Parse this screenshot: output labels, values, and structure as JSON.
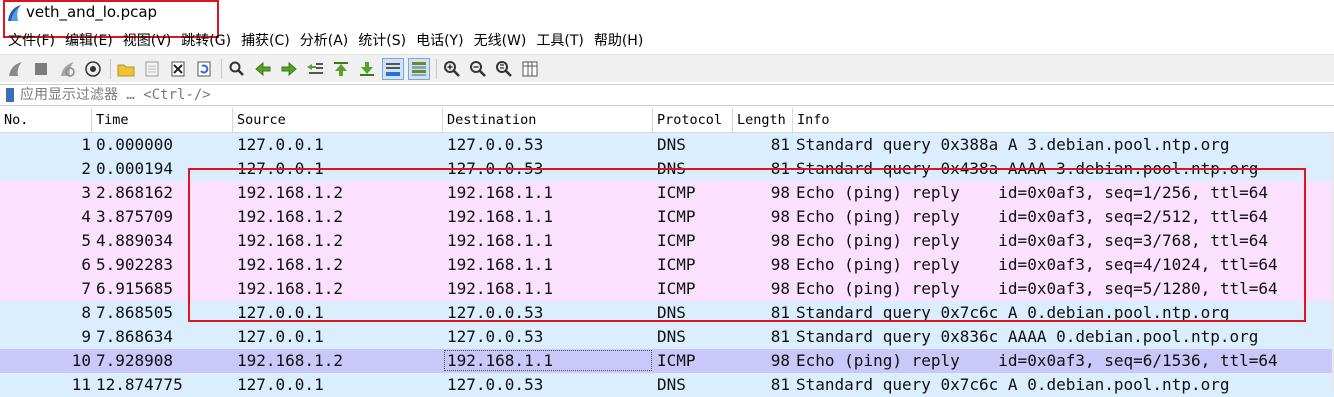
{
  "window": {
    "title": "veth_and_lo.pcap",
    "icon": "wireshark-fin-icon"
  },
  "menu": [
    "文件(F)",
    "编辑(E)",
    "视图(V)",
    "跳转(G)",
    "捕获(C)",
    "分析(A)",
    "统计(S)",
    "电话(Y)",
    "无线(W)",
    "工具(T)",
    "帮助(H)"
  ],
  "toolbar": {
    "icons": [
      "start-capture-icon",
      "stop-capture-icon",
      "restart-capture-icon",
      "capture-options-icon",
      "open-file-icon",
      "save-file-icon",
      "close-file-icon",
      "reload-file-icon",
      "find-packet-icon",
      "go-back-icon",
      "go-forward-icon",
      "go-to-packet-icon",
      "go-first-icon",
      "go-last-icon",
      "autoscroll-icon",
      "colorize-icon",
      "zoom-in-icon",
      "zoom-out-icon",
      "zoom-normal-icon",
      "resize-columns-icon"
    ]
  },
  "filter": {
    "placeholder": "应用显示过滤器 … <Ctrl-/>"
  },
  "columns": {
    "no": "No.",
    "time": "Time",
    "source": "Source",
    "destination": "Destination",
    "protocol": "Protocol",
    "length": "Length",
    "info": "Info"
  },
  "packets": [
    {
      "no": "1",
      "time": "0.000000",
      "src": "127.0.0.1",
      "dst": "127.0.0.53",
      "proto": "DNS",
      "len": "81",
      "info": "Standard query 0x388a A 3.debian.pool.ntp.org"
    },
    {
      "no": "2",
      "time": "0.000194",
      "src": "127.0.0.1",
      "dst": "127.0.0.53",
      "proto": "DNS",
      "len": "81",
      "info": "Standard query 0x438a AAAA 3.debian.pool.ntp.org"
    },
    {
      "no": "3",
      "time": "2.868162",
      "src": "192.168.1.2",
      "dst": "192.168.1.1",
      "proto": "ICMP",
      "len": "98",
      "info": "Echo (ping) reply    id=0x0af3, seq=1/256, ttl=64"
    },
    {
      "no": "4",
      "time": "3.875709",
      "src": "192.168.1.2",
      "dst": "192.168.1.1",
      "proto": "ICMP",
      "len": "98",
      "info": "Echo (ping) reply    id=0x0af3, seq=2/512, ttl=64"
    },
    {
      "no": "5",
      "time": "4.889034",
      "src": "192.168.1.2",
      "dst": "192.168.1.1",
      "proto": "ICMP",
      "len": "98",
      "info": "Echo (ping) reply    id=0x0af3, seq=3/768, ttl=64"
    },
    {
      "no": "6",
      "time": "5.902283",
      "src": "192.168.1.2",
      "dst": "192.168.1.1",
      "proto": "ICMP",
      "len": "98",
      "info": "Echo (ping) reply    id=0x0af3, seq=4/1024, ttl=64"
    },
    {
      "no": "7",
      "time": "6.915685",
      "src": "192.168.1.2",
      "dst": "192.168.1.1",
      "proto": "ICMP",
      "len": "98",
      "info": "Echo (ping) reply    id=0x0af3, seq=5/1280, ttl=64"
    },
    {
      "no": "8",
      "time": "7.868505",
      "src": "127.0.0.1",
      "dst": "127.0.0.53",
      "proto": "DNS",
      "len": "81",
      "info": "Standard query 0x7c6c A 0.debian.pool.ntp.org"
    },
    {
      "no": "9",
      "time": "7.868634",
      "src": "127.0.0.1",
      "dst": "127.0.0.53",
      "proto": "DNS",
      "len": "81",
      "info": "Standard query 0x836c AAAA 0.debian.pool.ntp.org"
    },
    {
      "no": "10",
      "time": "7.928908",
      "src": "192.168.1.2",
      "dst": "192.168.1.1",
      "proto": "ICMP",
      "len": "98",
      "info": "Echo (ping) reply    id=0x0af3, seq=6/1536, ttl=64"
    },
    {
      "no": "11",
      "time": "12.874775",
      "src": "127.0.0.1",
      "dst": "127.0.0.53",
      "proto": "DNS",
      "len": "81",
      "info": "Standard query 0x7c6c A 0.debian.pool.ntp.org"
    }
  ],
  "selected_row": "10",
  "colors": {
    "udp_row": "#daeeff",
    "icmp_row": "#fce0ff",
    "selected_row": "#c9c8f8",
    "highlight_border": "#e0141e"
  }
}
